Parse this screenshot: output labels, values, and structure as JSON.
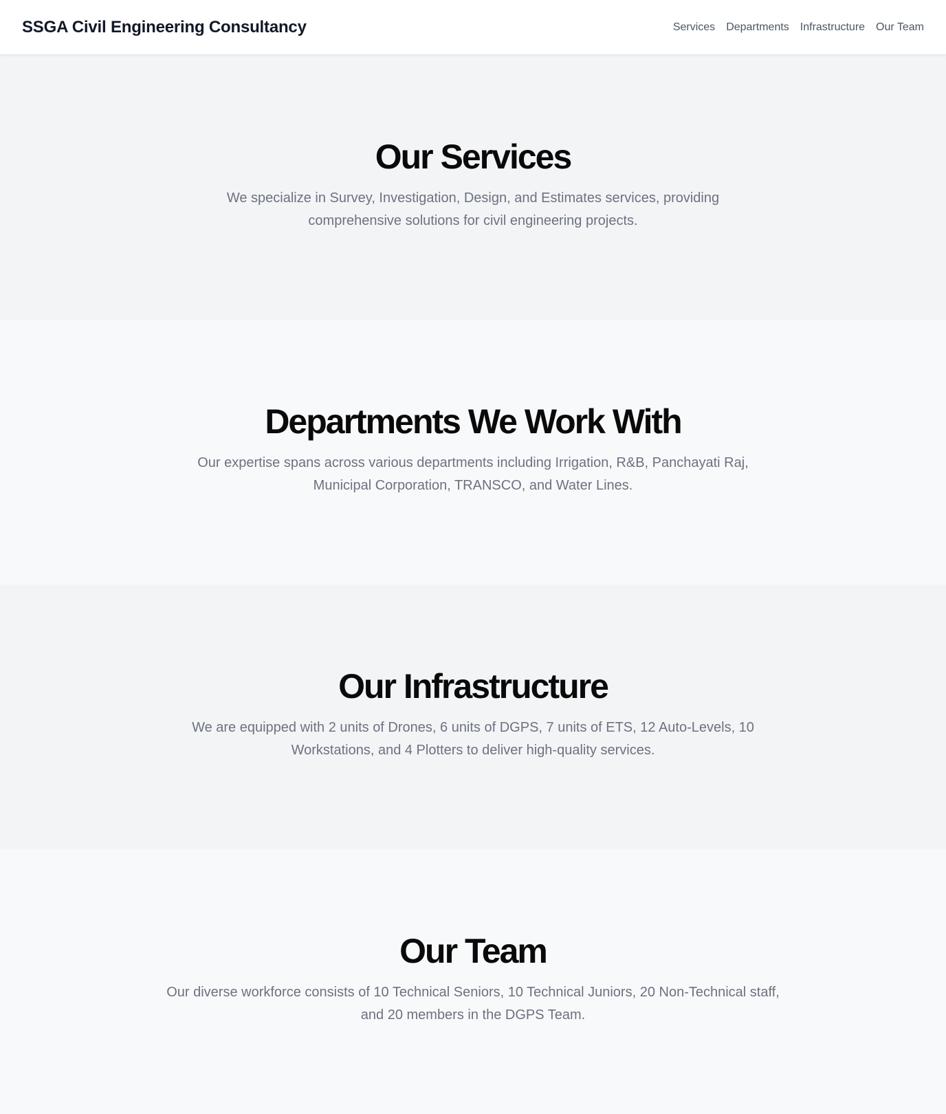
{
  "header": {
    "brand": "SSGA Civil Engineering Consultancy",
    "nav": {
      "services": "Services",
      "departments": "Departments",
      "infrastructure": "Infrastructure",
      "team": "Our Team"
    }
  },
  "sections": {
    "services": {
      "title": "Our Services",
      "text": "We specialize in Survey, Investigation, Design, and Estimates services, providing comprehensive solutions for civil engineering projects."
    },
    "departments": {
      "title": "Departments We Work With",
      "text": "Our expertise spans across various departments including Irrigation, R&B, Panchayati Raj, Municipal Corporation, TRANSCO, and Water Lines."
    },
    "infrastructure": {
      "title": "Our Infrastructure",
      "text": "We are equipped with 2 units of Drones, 6 units of DGPS, 7 units of ETS, 12 Auto-Levels, 10 Workstations, and 4 Plotters to deliver high-quality services."
    },
    "team": {
      "title": "Our Team",
      "text": "Our diverse workforce consists of 10 Technical Seniors, 10 Technical Juniors, 20 Non-Technical staff, and 20 members in the DGPS Team."
    }
  },
  "colors": {
    "header_bg": "#ffffff",
    "section_gray": "#f3f4f6",
    "section_light": "#f8f9fa",
    "heading": "#0a0a0a",
    "body_text": "#6b7280",
    "nav_text": "#4b5563"
  }
}
